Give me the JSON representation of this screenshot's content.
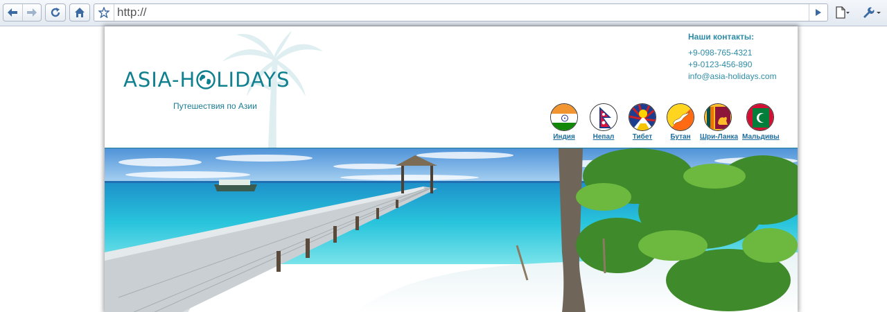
{
  "browser": {
    "address_value": "http://",
    "icons": {
      "back": "arrow-left-icon",
      "forward": "arrow-right-icon",
      "reload": "reload-icon",
      "home": "home-icon",
      "bookmark": "star-icon",
      "go": "play-icon",
      "page_menu": "page-icon",
      "tools_menu": "wrench-icon"
    }
  },
  "site": {
    "logo_text_left": "ASIA-H",
    "logo_text_right": "LIDAYS",
    "tagline": "Путешествия по Азии",
    "contacts": {
      "title": "Наши контакты:",
      "phone1": "+9-098-765-4321",
      "phone2": "+9-0123-456-890",
      "email": "info@asia-holidays.com"
    },
    "countries": [
      {
        "label": "Индия",
        "flag": "india-flag"
      },
      {
        "label": "Непал",
        "flag": "nepal-flag"
      },
      {
        "label": "Тибет",
        "flag": "tibet-flag"
      },
      {
        "label": "Бутан",
        "flag": "bhutan-flag"
      },
      {
        "label": "Шри-Ланка",
        "flag": "sri-lanka-flag"
      },
      {
        "label": "Мальдивы",
        "flag": "maldives-flag"
      }
    ]
  },
  "colors": {
    "brand": "#10808f",
    "link": "#1c6c9c",
    "contact": "#2d8ca6"
  }
}
